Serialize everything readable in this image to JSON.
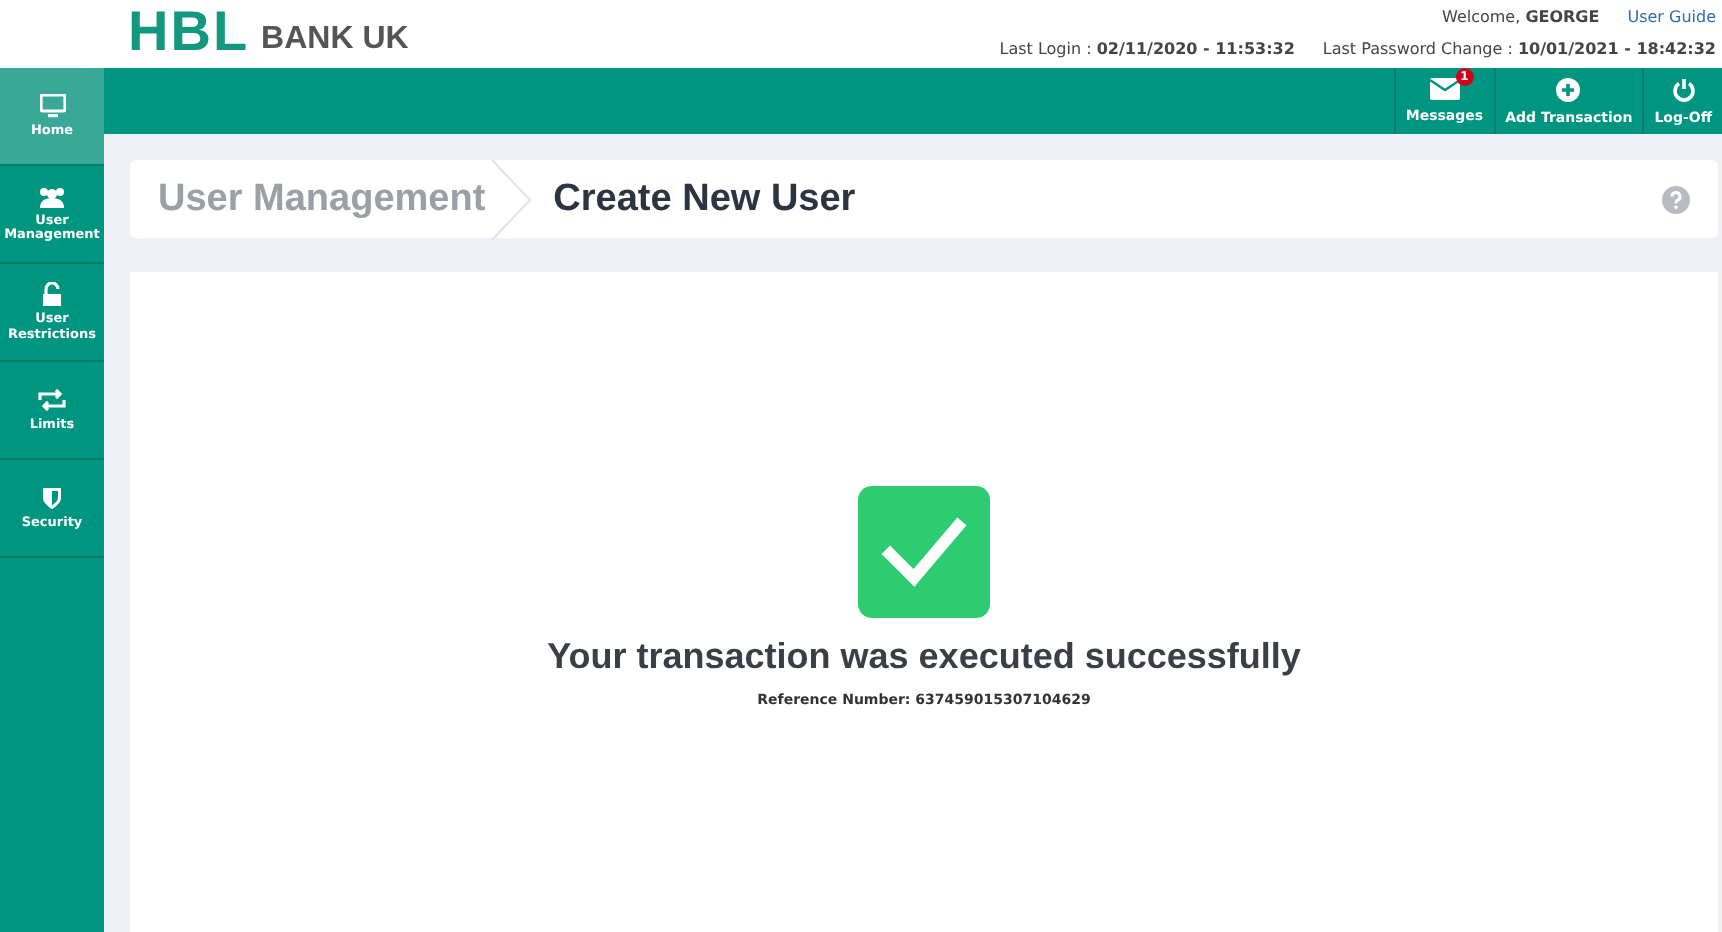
{
  "logo": {
    "mark": "HBL",
    "text": "BANK UK"
  },
  "header": {
    "welcome": "Welcome, **GEORGE**",
    "user_guide": "User Guide",
    "last_login": "Last Login : **02/11/2020 - 11:53:32**",
    "last_password_change": "Last Password Change : **10/01/2021 - 18:42:32**"
  },
  "sidebar": {
    "items": [
      {
        "label": "Home",
        "selected": true
      },
      {
        "label": "User Management",
        "selected": false
      },
      {
        "label": "User Restrictions",
        "selected": false
      },
      {
        "label": "Limits",
        "selected": false
      },
      {
        "label": "Security",
        "selected": false
      }
    ]
  },
  "toolbar": [
    {
      "label": "Messages",
      "badge": "1"
    },
    {
      "label": "Add Transaction"
    },
    {
      "label": "Log-Off"
    }
  ],
  "breadcrumb": [
    {
      "label": "User Management",
      "selected": false
    },
    {
      "label": "Create New User",
      "selected": true
    }
  ],
  "result": {
    "message": "Your transaction was executed successfully",
    "reference": "Reference Number: 637459015307104629"
  }
}
